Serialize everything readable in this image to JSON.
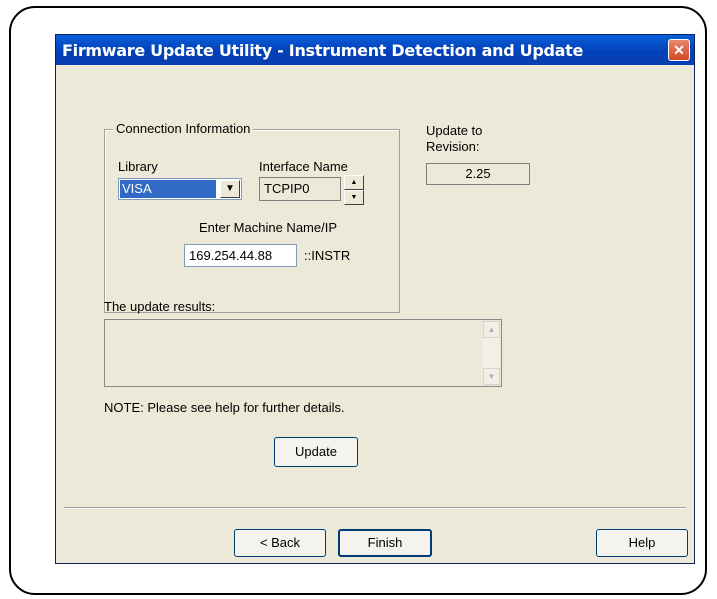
{
  "window": {
    "title": "Firmware Update Utility - Instrument Detection and Update",
    "close_glyph": "✕"
  },
  "connection": {
    "group_label": "Connection Information",
    "library_label": "Library",
    "library_value": "VISA",
    "interface_label": "Interface Name",
    "interface_value": "TCPIP0",
    "machine_label": "Enter Machine Name/IP",
    "machine_value": "169.254.44.88",
    "instr_suffix": "::INSTR"
  },
  "revision": {
    "label_line1": "Update to",
    "label_line2": "Revision:",
    "value": "2.25"
  },
  "results": {
    "label": "The update results:",
    "value": ""
  },
  "note": "NOTE: Please see help for further details.",
  "buttons": {
    "update": "Update",
    "back": "< Back",
    "finish": "Finish",
    "help": "Help"
  },
  "icons": {
    "close": "close-icon",
    "dropdown": "chevron-down-icon",
    "spin_up": "arrow-up-icon",
    "spin_down": "arrow-down-icon",
    "scroll_up": "scroll-up-icon",
    "scroll_down": "scroll-down-icon"
  },
  "colors": {
    "titlebar": "#0a4fd0",
    "dialog_bg": "#ece9d8",
    "selection": "#316ac5",
    "close_button": "#d44a22"
  }
}
